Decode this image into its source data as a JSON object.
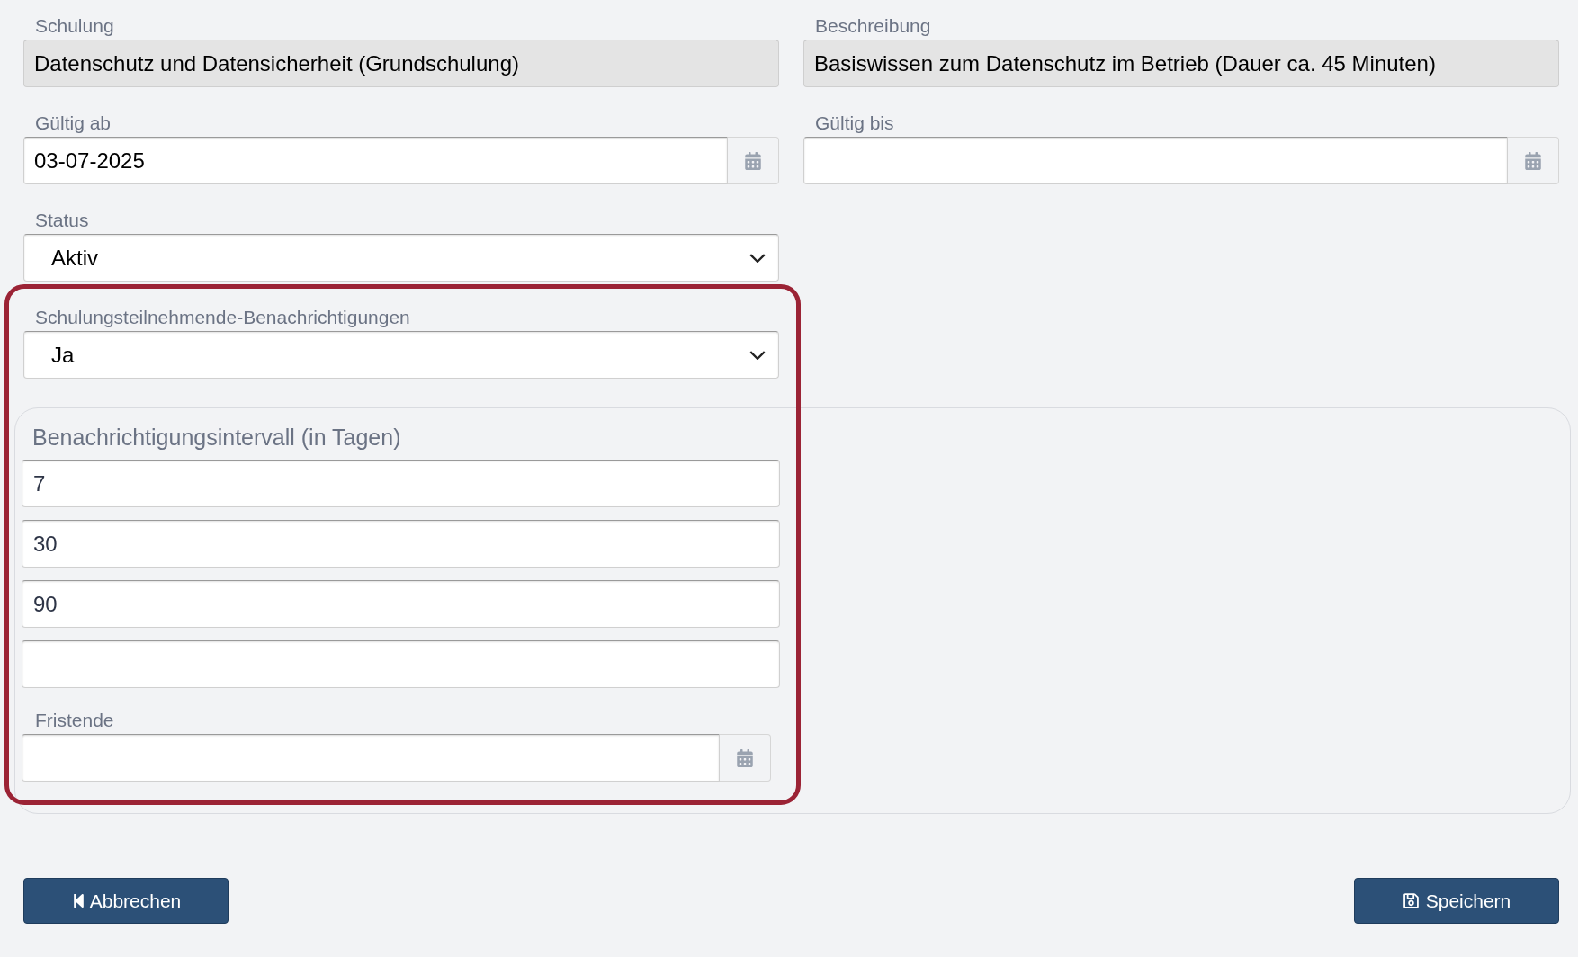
{
  "rows": [
    [
      {
        "label": "Schulung",
        "kind": "readonly",
        "value": "Datenschutz und Datensicherheit (Grundschulung)"
      },
      {
        "label": "Beschreibung",
        "kind": "readonly",
        "value": "Basiswissen zum Datenschutz im Betrieb (Dauer ca. 45 Minuten)"
      }
    ],
    [
      {
        "label": "Gültig ab",
        "kind": "date",
        "value": "03-07-2025"
      },
      {
        "label": "Gültig bis",
        "kind": "date"
      }
    ],
    [
      {
        "label": "Status",
        "kind": "select",
        "value": "Aktiv"
      }
    ]
  ],
  "notifications": {
    "highlighted": true,
    "label": "Schulungsteilnehmende-Benachrichtigungen",
    "value": "Ja"
  },
  "interval": {
    "title": "Benachrichtigungsintervall (in Tagen)",
    "entries": [
      {
        "kind": "filled",
        "value": "7"
      },
      {
        "kind": "filled",
        "value": "30"
      },
      {
        "kind": "filled",
        "value": "90"
      },
      {
        "kind": "blank"
      }
    ]
  },
  "deadline": {
    "label": "Fristende"
  },
  "buttons": [
    {
      "kind": "back",
      "label": "Abbrechen"
    },
    {
      "kind": "save",
      "label": "Speichern"
    }
  ]
}
